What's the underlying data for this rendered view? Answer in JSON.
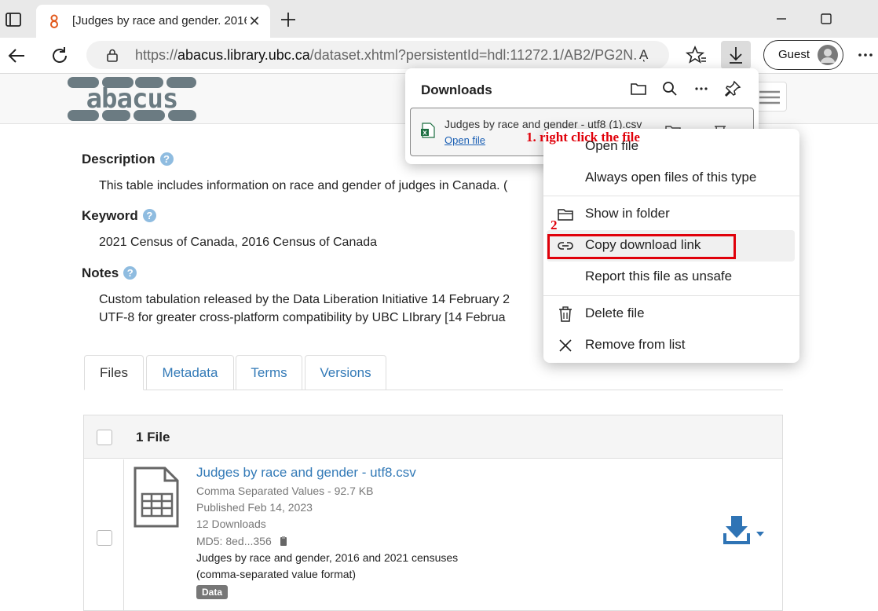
{
  "browser": {
    "tab_title": "[Judges by race and gender. 2016",
    "url_prefix": "https://",
    "url_host": "abacus.library.ubc.ca",
    "url_rest": "/dataset.xhtml?persistentId=hdl:11272.1/AB2/PG2N...",
    "read_aloud": "Aͅ",
    "profile_label": "Guest"
  },
  "site": {
    "logo_text": "abacus"
  },
  "metadata": {
    "description_label": "Description",
    "description_value": "This table includes information on race and gender of judges in Canada. (",
    "keyword_label": "Keyword",
    "keyword_value": "2021 Census of Canada, 2016 Census of Canada",
    "notes_label": "Notes",
    "notes_line1": "Custom tabulation released by the Data Liberation Initiative 14 February 2",
    "notes_line2": "UTF-8 for greater cross-platform compatibility by UBC LIbrary [14 Februa"
  },
  "page_tabs": [
    "Files",
    "Metadata",
    "Terms",
    "Versions"
  ],
  "files": {
    "count_label": "1 File",
    "item": {
      "name": "Judges by race and gender - utf8.csv",
      "type_size": "Comma Separated Values - 92.7 KB",
      "published": "Published Feb 14, 2023",
      "downloads": "12 Downloads",
      "md5": "MD5: 8ed...356",
      "desc_line1": "Judges by race and gender, 2016 and 2021 censuses",
      "desc_line2": "(comma-separated value format)",
      "tag": "Data"
    }
  },
  "downloads_panel": {
    "title": "Downloads",
    "item_name": "Judges by race and gender - utf8 (1).csv",
    "open_file": "Open file"
  },
  "annotations": {
    "step1": "1. right click the file",
    "step2": "2"
  },
  "context_menu": {
    "items": [
      "Open file",
      "Always open files of this type",
      "Show in folder",
      "Copy download link",
      "Report this file as unsafe",
      "Delete file",
      "Remove from list"
    ]
  },
  "colors": {
    "link_blue": "#337ab7",
    "annotation_red": "#e0000a",
    "logo_gray": "#6b7b82"
  }
}
